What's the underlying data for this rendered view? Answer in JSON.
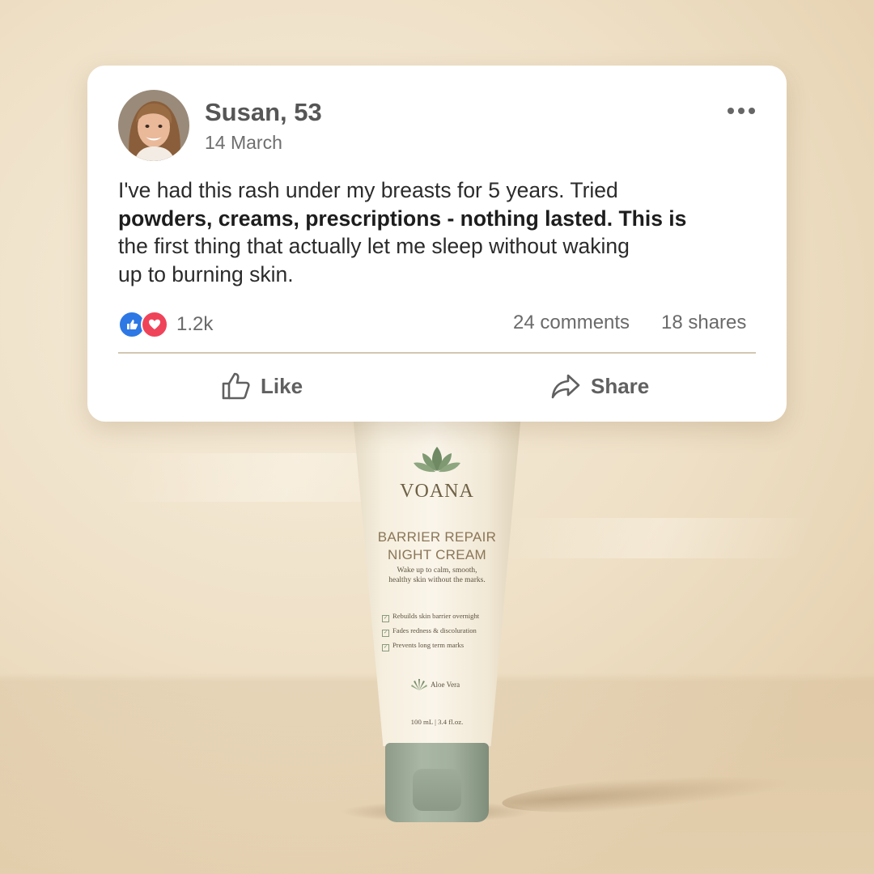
{
  "post": {
    "author": "Susan, 53",
    "date": "14 March",
    "body_line1": "I've had this rash under my breasts for 5 years. Tried",
    "body_line2": "powders, creams, prescriptions - nothing lasted. This is",
    "body_line3": "the first thing that actually let me sleep without waking",
    "body_line4": "up to burning skin.",
    "reaction_count": "1.2k",
    "comments": "24 comments",
    "shares": "18 shares",
    "like_label": "Like",
    "share_label": "Share",
    "reaction_icons": [
      "like-icon",
      "love-icon"
    ]
  },
  "product": {
    "brand": "VOANA",
    "title_line1": "BARRIER REPAIR",
    "title_line2": "NIGHT CREAM",
    "tagline_line1": "Wake up to calm, smooth,",
    "tagline_line2": "healthy skin without the marks.",
    "benefits": [
      "Rebuilds skin barrier overnight",
      "Fades redness & discoluration",
      "Prevents long term marks"
    ],
    "ingredient": "Aloe Vera",
    "size": "100 mL | 3.4 fl.oz."
  },
  "colors": {
    "like_blue": "#2d78e4",
    "love_red": "#ef4359",
    "cap_sage": "#a3b09e",
    "background_cream": "#efe1c8"
  }
}
